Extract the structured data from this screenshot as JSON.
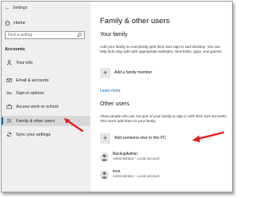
{
  "window": {
    "title": "Settings"
  },
  "sidebar": {
    "home_label": "Home",
    "search_placeholder": "Find a setting",
    "section_label": "Accounts",
    "items": [
      {
        "label": "Your info",
        "icon": "person-icon"
      },
      {
        "label": "Email & accounts",
        "icon": "mail-icon"
      },
      {
        "label": "Sign-in options",
        "icon": "key-icon"
      },
      {
        "label": "Access work or school",
        "icon": "briefcase-icon"
      },
      {
        "label": "Family & other users",
        "icon": "family-icon",
        "selected": true
      },
      {
        "label": "Sync your settings",
        "icon": "sync-icon"
      }
    ]
  },
  "main": {
    "title": "Family & other users",
    "your_family": {
      "heading": "Your family",
      "description": "Add your family so everybody gets their own sign-in and desktop. You can help kids stay safe with appropriate websites, time limits, apps, and games.",
      "add_label": "Add a family member",
      "learn_more": "Learn more"
    },
    "other_users": {
      "heading": "Other users",
      "description": "Allow people who are not part of your family to sign in with their own accounts. This won't add them to your family.",
      "add_label": "Add someone else to this PC",
      "users": [
        {
          "name": "BackupAdmin",
          "role": "Administrator - Local account"
        },
        {
          "name": "leon",
          "role": "Administrator - Local account"
        }
      ]
    }
  },
  "colors": {
    "accent": "#0067b8",
    "arrow": "#e02020",
    "sidebar_bg": "#efefef"
  }
}
